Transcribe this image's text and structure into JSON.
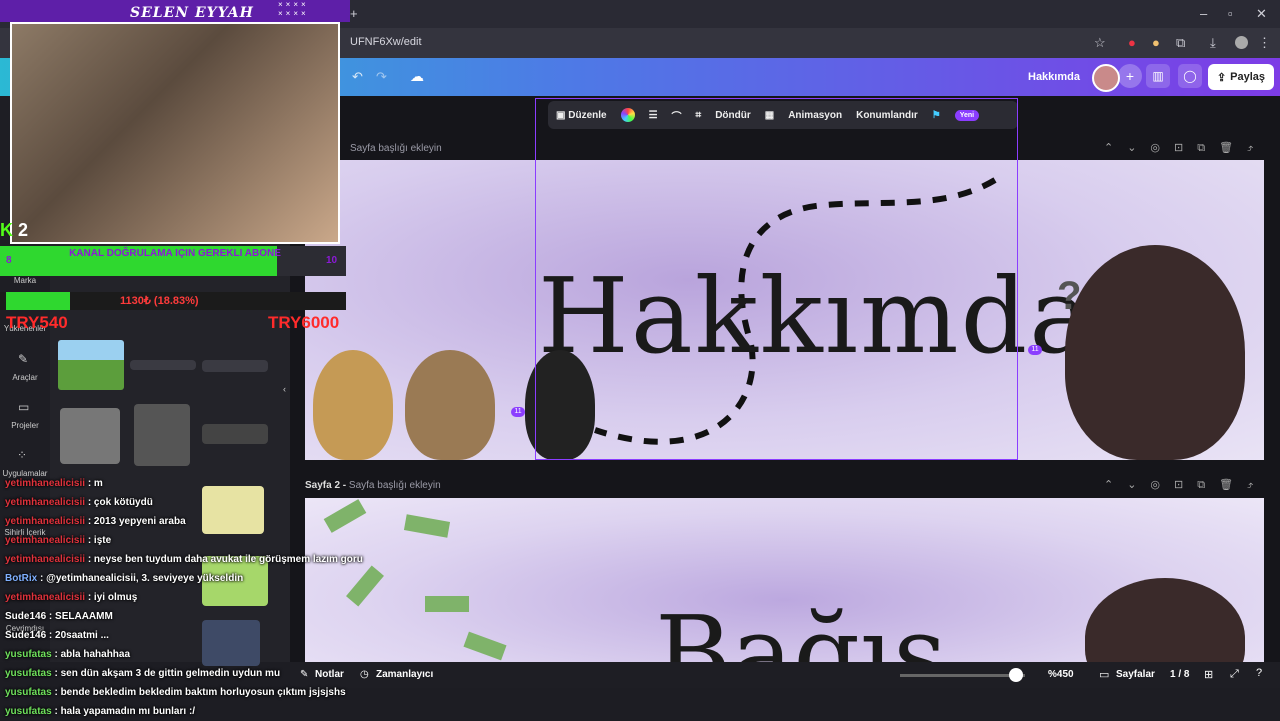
{
  "browser": {
    "url": "UFNF6Xw/edit",
    "new_tab": "+"
  },
  "canva": {
    "doc_title": "Hakkımda",
    "share_label": "Paylaş",
    "toolbar": {
      "edit": "Düzenle",
      "rotate": "Döndür",
      "animate": "Animasyon",
      "position": "Konumlandır",
      "new_badge": "Yeni"
    },
    "page1": {
      "label_placeholder": "Sayfa başlığı ekleyin",
      "title": "Hakkımda",
      "badge_num": "11"
    },
    "page2": {
      "label_prefix": "Sayfa 2 -",
      "label_placeholder": "Sayfa başlığı ekleyin",
      "title": "Bağış"
    },
    "left_rail": [
      "Marka",
      "Yüklenenler",
      "Araçlar",
      "Projeler",
      "Uygulamalar",
      "Sihirli İçerik",
      "Çevrimdışı"
    ],
    "bottom": {
      "notes": "Notlar",
      "timer": "Zamanlayıcı",
      "zoom": "%450",
      "zoom_level": 0.93,
      "pages": "Sayfalar",
      "page_count": "1 / 8"
    }
  },
  "stream": {
    "streamer_name": "SELEN EYYAH",
    "viewer_count": "2",
    "sub_goal": {
      "current": "8",
      "target": "10",
      "text": "KANAL DOĞRULAMA IÇIN GEREKLI ABONE",
      "progress": 0.8
    },
    "donation_goal": {
      "text": "1130₺ (18.83%)",
      "progress": 0.1883,
      "left_amount": "TRY540",
      "right_amount": "TRY6000"
    },
    "chat": [
      {
        "user": "yetimhanealicisii",
        "msg": ": m",
        "color": "red"
      },
      {
        "user": "yetimhanealicisii",
        "msg": ": çok kötüydü",
        "color": "red"
      },
      {
        "user": "yetimhanealicisii",
        "msg": ": 2013 yepyeni araba",
        "color": "red"
      },
      {
        "user": "yetimhanealicisii",
        "msg": ": işte",
        "color": "red"
      },
      {
        "user": "yetimhanealicisii",
        "msg": ": neyse ben tuydum daha avukat ile görüşmem lazım goru",
        "color": "red"
      },
      {
        "user": "BotRix",
        "msg": ": @yetimhanealicisii, 3. seviyeye yükseldin",
        "color": "blue"
      },
      {
        "user": "yetimhanealicisii",
        "msg": ": iyi olmuş",
        "color": "red"
      },
      {
        "user": "Sude146",
        "msg": ": SELAAAMM",
        "color": "white"
      },
      {
        "user": "Sude146",
        "msg": ": 20saatmi ...",
        "color": "white"
      },
      {
        "user": "yusufatas",
        "msg": ": abla hahahhaa",
        "color": "green"
      },
      {
        "user": "yusufatas",
        "msg": ": sen dün akşam 3 de gittin gelmedin uydun mu",
        "color": "green"
      },
      {
        "user": "yusufatas",
        "msg": ": bende bekledim bekledim baktım horluyosun çıktım jsjsjshs",
        "color": "green"
      },
      {
        "user": "yusufatas",
        "msg": ": hala yapamadın mı bunları :/",
        "color": "green"
      }
    ]
  }
}
